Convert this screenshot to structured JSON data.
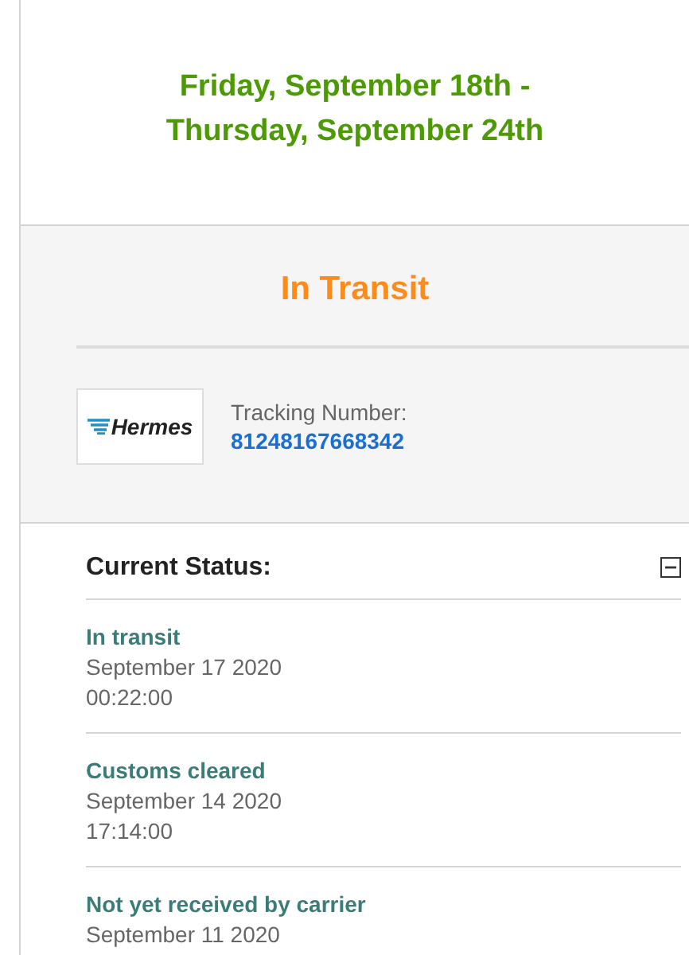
{
  "delivery_window": {
    "line_1": "Friday, September 18th -",
    "line_2": "Thursday, September 24th"
  },
  "shipment": {
    "status": "In Transit",
    "carrier_logo": "Hermes",
    "tracking_label": "Tracking Number:",
    "tracking_number": "81248167668342"
  },
  "history": {
    "title": "Current Status:",
    "expanded": true,
    "events": [
      {
        "status": "In transit",
        "date": "September 17 2020",
        "time": "00:22:00"
      },
      {
        "status": "Customs cleared",
        "date": "September 14 2020",
        "time": "17:14:00"
      },
      {
        "status": "Not yet received by carrier",
        "date": "September 11 2020"
      }
    ]
  }
}
